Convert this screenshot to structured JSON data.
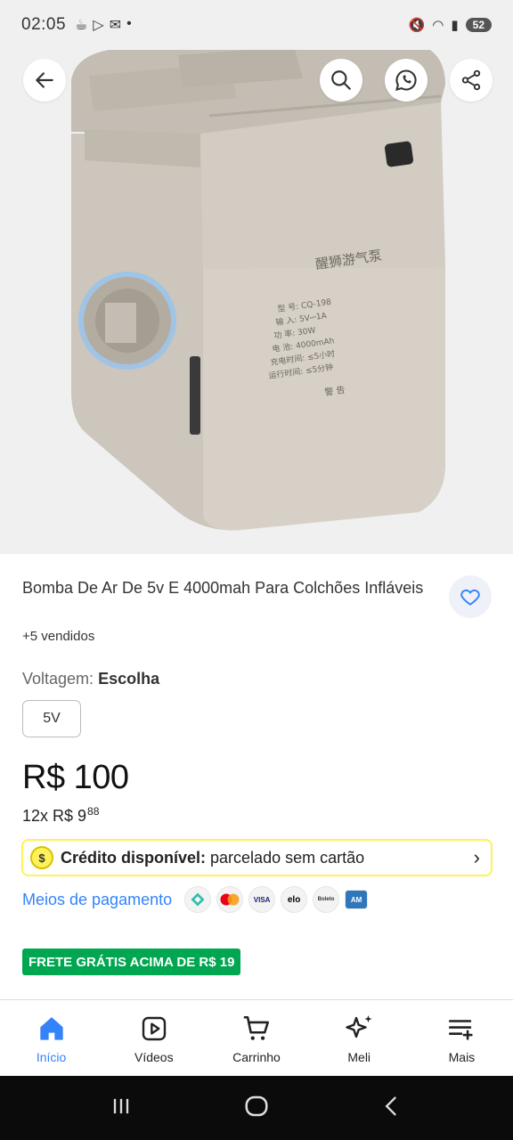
{
  "status": {
    "time": "02:05",
    "battery": "52"
  },
  "product": {
    "title": "Bomba De Ar De 5v E 4000mah Para Colchões Infláveis",
    "sold": "+5 vendidos",
    "variant_label": "Voltagem:",
    "variant_value": "Escolha",
    "variant_option": "5V",
    "price": "R$ 100",
    "installments_prefix": "12x R$ 9",
    "installments_cents": "88"
  },
  "device_label": {
    "title": "醒狮游气泵",
    "model": "型 号: CQ-198",
    "input": "输 入: 5V⎓1A",
    "power": "功 率: 30W",
    "battery": "电 池: 4000mAh",
    "charge": "充电时间: ≤5小时",
    "runtime": "运行时间: ≤5分钟",
    "warning": "警 告"
  },
  "credit": {
    "label": "Crédito disponível:",
    "text": "parcelado sem cartão"
  },
  "payments": {
    "label": "Meios de pagamento",
    "methods": [
      "pix-icon",
      "mastercard-icon",
      "visa-icon",
      "elo-icon",
      "boleto-icon",
      "amex-icon"
    ],
    "visa": "VISA",
    "elo": "elo",
    "boleto": "Boleto",
    "amex": "AM"
  },
  "shipping_badge": "FRETE GRÁTIS ACIMA DE R$ 19",
  "nav": [
    {
      "label": "Início",
      "icon": "home-icon",
      "active": true
    },
    {
      "label": "Vídeos",
      "icon": "video-icon",
      "active": false
    },
    {
      "label": "Carrinho",
      "icon": "cart-icon",
      "active": false
    },
    {
      "label": "Meli",
      "icon": "sparkle-icon",
      "active": false
    },
    {
      "label": "Mais",
      "icon": "menu-plus-icon",
      "active": false
    }
  ],
  "colors": {
    "accent": "#3483fa",
    "credit_border": "#fff159",
    "shipping": "#00a650"
  }
}
